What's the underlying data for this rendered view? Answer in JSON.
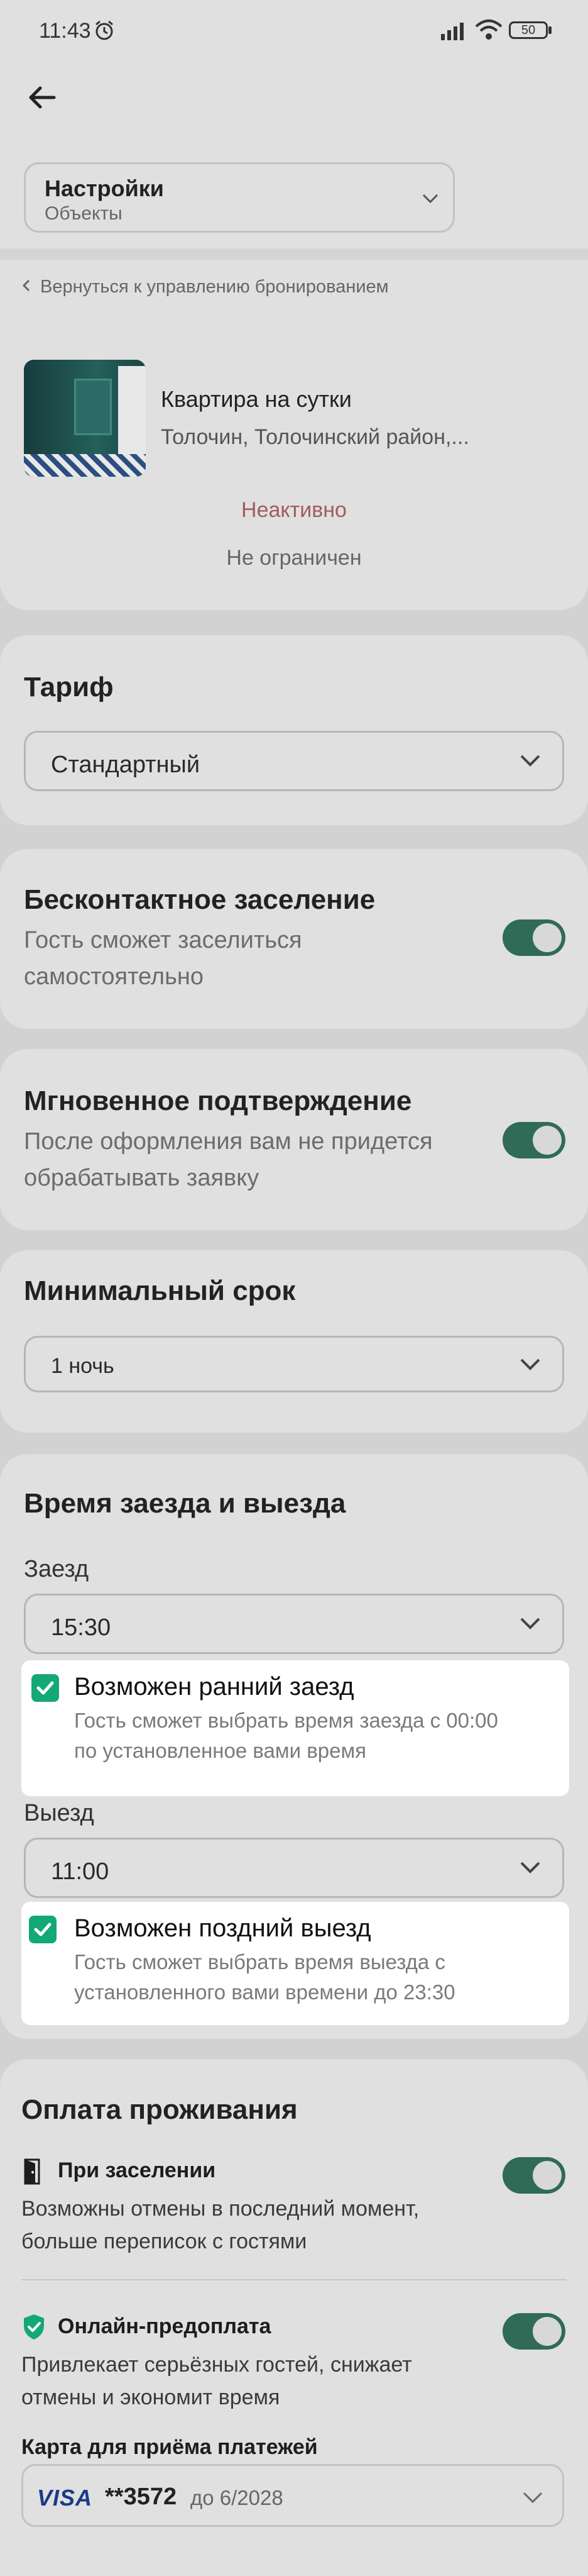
{
  "status_bar": {
    "time": "11:43",
    "battery": "50"
  },
  "header": {
    "dropdown_title": "Настройки",
    "dropdown_subtitle": "Объекты",
    "back_link": "Вернуться к управлению бронированием"
  },
  "property": {
    "name": "Квартира на сутки",
    "address": "Толочин, Толочинский район,...",
    "status": "Неактивно",
    "limit": "Не ограничен"
  },
  "tariff": {
    "title": "Тариф",
    "selected": "Стандартный"
  },
  "contactless": {
    "title": "Бесконтактное заселение",
    "description_line1": "Гость сможет заселиться",
    "description_line2": "самостоятельно",
    "enabled": true
  },
  "instant": {
    "title": "Мгновенное подтверждение",
    "description_line1": "После оформления вам не придется",
    "description_line2": "обрабатывать заявку",
    "enabled": true
  },
  "min_stay": {
    "title": "Минимальный срок",
    "selected": "1 ночь"
  },
  "checkin_checkout": {
    "title": "Время заезда и выезда",
    "checkin_label": "Заезд",
    "checkin_time": "15:30",
    "early_checkin": {
      "label": "Возможен ранний заезд",
      "description_line1": "Гость сможет выбрать время заезда с 00:00",
      "description_line2": "по установленное вами время",
      "checked": true
    },
    "checkout_label": "Выезд",
    "checkout_time": "11:00",
    "late_checkout": {
      "label": "Возможен поздний выезд",
      "description_line1": "Гость сможет выбрать время выезда с",
      "description_line2": "установленного вами времени до 23:30",
      "checked": true
    }
  },
  "payment": {
    "title": "Оплата проживания",
    "on_arrival": {
      "title": "При заселении",
      "description_line1": "Возможны отмены в последний момент,",
      "description_line2": "больше переписок с гостями",
      "enabled": true
    },
    "prepayment": {
      "title": "Онлайн-предоплата",
      "description_line1": "Привлекает серьёзных гостей, снижает",
      "description_line2": "отмены и экономит время",
      "enabled": true
    },
    "card_label": "Карта для приёма платежей",
    "card_brand": "VISA",
    "card_number": "**3572",
    "card_expiry": "до 6/2028"
  },
  "colors": {
    "toggle_on": "#2f6b57",
    "checkbox": "#12a878",
    "status_inactive": "#a25c5c"
  }
}
